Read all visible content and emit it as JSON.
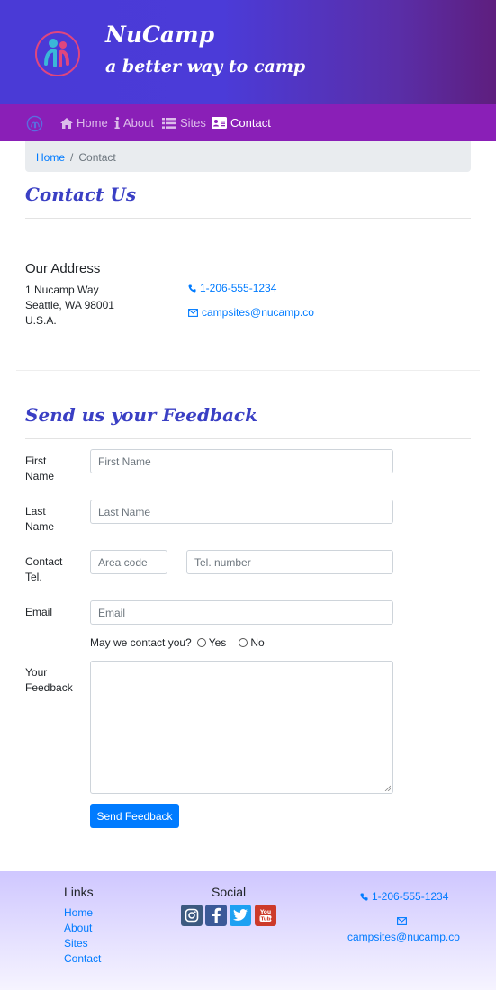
{
  "header": {
    "brand": "NuCamp",
    "tagline": "a better way to camp"
  },
  "nav": {
    "items": [
      {
        "label": "Home",
        "icon": "home-icon"
      },
      {
        "label": "About",
        "icon": "info-icon"
      },
      {
        "label": "Sites",
        "icon": "list-icon"
      },
      {
        "label": "Contact",
        "icon": "address-card-icon",
        "active": true
      }
    ]
  },
  "breadcrumb": {
    "home": "Home",
    "separator": "/",
    "current": "Contact"
  },
  "contact": {
    "heading": "Contact Us",
    "address_title": "Our Address",
    "address_lines": [
      "1 Nucamp Way",
      "Seattle, WA 98001",
      "U.S.A."
    ],
    "phone": "1-206-555-1234",
    "email": "campsites@nucamp.co"
  },
  "feedback": {
    "heading": "Send us your Feedback",
    "first_name_label": "First Name",
    "first_name_placeholder": "First Name",
    "last_name_label": "Last Name",
    "last_name_placeholder": "Last Name",
    "tel_label": "Contact Tel.",
    "area_code_placeholder": "Area code",
    "tel_number_placeholder": "Tel. number",
    "email_label": "Email",
    "email_placeholder": "Email",
    "may_contact": "May we contact you?",
    "yes": "Yes",
    "no": "No",
    "your_feedback_label": "Your Feedback",
    "send_label": "Send Feedback"
  },
  "footer": {
    "links_title": "Links",
    "links": [
      "Home",
      "About",
      "Sites",
      "Contact"
    ],
    "social_title": "Social",
    "social_icons": [
      "instagram-icon",
      "facebook-icon",
      "twitter-icon",
      "youtube-icon"
    ],
    "phone": "1-206-555-1234",
    "email": "campsites@nucamp.co"
  },
  "colors": {
    "primary": "#007bff",
    "navbar": "#8a1fb7",
    "heading": "#3a3fc4"
  }
}
